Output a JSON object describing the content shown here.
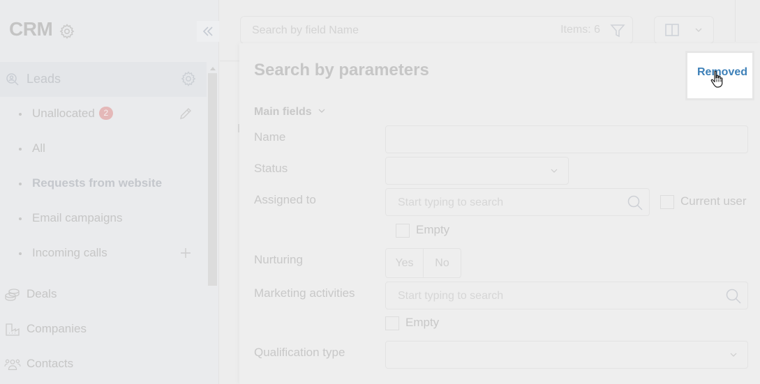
{
  "sidebar": {
    "title": "CRM",
    "leads": {
      "label": "Leads"
    },
    "lead_items": [
      {
        "label": "Unallocated",
        "badge": "2",
        "bold": false,
        "action_icon": "pencil-icon"
      },
      {
        "label": "All",
        "bold": false
      },
      {
        "label": "Requests from website",
        "bold": true
      },
      {
        "label": "Email campaigns",
        "bold": false
      },
      {
        "label": "Incoming calls",
        "bold": false,
        "action_icon": "plus-icon"
      }
    ],
    "nav": [
      {
        "label": "Deals",
        "icon": "coins-icon"
      },
      {
        "label": "Companies",
        "icon": "factory-icon"
      },
      {
        "label": "Contacts",
        "icon": "people-icon"
      }
    ]
  },
  "toolbar": {
    "search_placeholder": "Search by field Name",
    "items_count": "Items: 6"
  },
  "panel": {
    "title": "Search by parameters",
    "section": "Main fields",
    "fields": {
      "name_label": "Name",
      "name_value": "",
      "status_label": "Status",
      "status_value": "",
      "assigned_label": "Assigned to",
      "assigned_placeholder": "Start typing to search",
      "current_user_label": "Current user",
      "assigned_empty_label": "Empty",
      "nurturing_label": "Nurturing",
      "nurturing_yes": "Yes",
      "nurturing_no": "No",
      "marketing_label": "Marketing activities",
      "marketing_placeholder": "Start typing to search",
      "marketing_empty_label": "Empty",
      "qualification_label": "Qualification type",
      "qualification_value": ""
    }
  },
  "popup": {
    "label": "Removed",
    "color": "#3d80b8"
  }
}
